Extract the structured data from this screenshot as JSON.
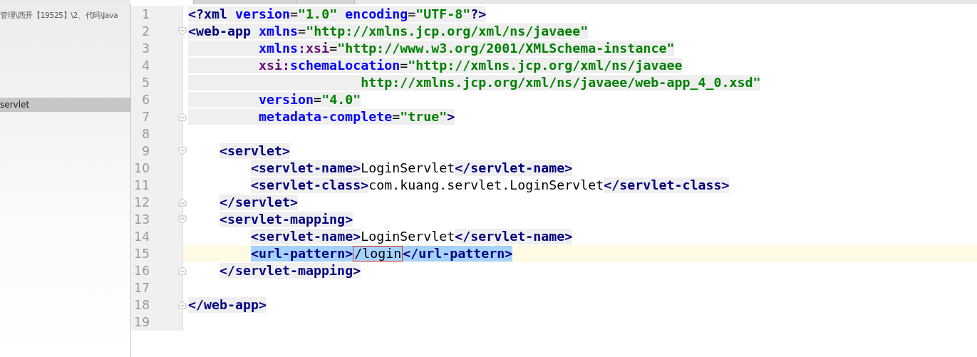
{
  "project_panel": {
    "path": "管理\\西开【19525】\\2、代码\\Java",
    "items": [
      {
        "label": "servlet",
        "selected": true
      }
    ]
  },
  "editor": {
    "lines": [
      {
        "number": "1",
        "fold_open": false,
        "fold_close": false,
        "current": false,
        "segments": [
          {
            "kind": "tag",
            "text": "<?xml"
          },
          {
            "kind": "attr",
            "text": " version"
          },
          {
            "kind": "plain",
            "text": "="
          },
          {
            "kind": "value",
            "text": "\"1.0\""
          },
          {
            "kind": "attr",
            "text": " encoding"
          },
          {
            "kind": "plain",
            "text": "="
          },
          {
            "kind": "value",
            "text": "\"UTF-8\""
          },
          {
            "kind": "tag",
            "text": "?>"
          }
        ]
      },
      {
        "number": "2",
        "fold_open": true,
        "fold_close": false,
        "current": false,
        "segments": [
          {
            "kind": "tag",
            "text": "<web-app"
          },
          {
            "kind": "attr",
            "text": " xmlns"
          },
          {
            "kind": "plain",
            "text": "="
          },
          {
            "kind": "value",
            "text": "\"http://xmlns.jcp.org/xml/ns/javaee\""
          }
        ]
      },
      {
        "number": "3",
        "fold_open": false,
        "fold_close": false,
        "current": false,
        "segments": [
          {
            "kind": "attr",
            "text": "         xmlns"
          },
          {
            "kind": "ns",
            "text": ":xsi"
          },
          {
            "kind": "plain",
            "text": "="
          },
          {
            "kind": "value",
            "text": "\"http://www.w3.org/2001/XMLSchema-instance\""
          }
        ]
      },
      {
        "number": "4",
        "fold_open": false,
        "fold_close": false,
        "current": false,
        "segments": [
          {
            "kind": "ns",
            "text": "         xsi:"
          },
          {
            "kind": "attr",
            "text": "schemaLocation"
          },
          {
            "kind": "plain",
            "text": "="
          },
          {
            "kind": "value",
            "text": "\"http://xmlns.jcp.org/xml/ns/javaee"
          }
        ]
      },
      {
        "number": "5",
        "fold_open": false,
        "fold_close": false,
        "current": false,
        "segments": [
          {
            "kind": "value",
            "text": "                      http://xmlns.jcp.org/xml/ns/javaee/web-app_4_0.xsd\""
          }
        ]
      },
      {
        "number": "6",
        "fold_open": false,
        "fold_close": false,
        "current": false,
        "segments": [
          {
            "kind": "attr",
            "text": "         version"
          },
          {
            "kind": "plain",
            "text": "="
          },
          {
            "kind": "value",
            "text": "\"4.0\""
          }
        ]
      },
      {
        "number": "7",
        "fold_open": false,
        "fold_close": true,
        "current": false,
        "segments": [
          {
            "kind": "attr",
            "text": "         metadata-complete"
          },
          {
            "kind": "plain",
            "text": "="
          },
          {
            "kind": "value",
            "text": "\"true\""
          },
          {
            "kind": "tag",
            "text": ">"
          }
        ]
      },
      {
        "number": "8",
        "fold_open": false,
        "fold_close": false,
        "current": false
      },
      {
        "number": "9",
        "fold_open": true,
        "fold_close": false,
        "current": false,
        "segments": [
          {
            "kind": "tag",
            "text": "    <servlet>"
          }
        ]
      },
      {
        "number": "10",
        "fold_open": false,
        "fold_close": false,
        "current": false,
        "segments": [
          {
            "kind": "tag",
            "text": "        <servlet-name>"
          },
          {
            "kind": "text",
            "text": "LoginServlet"
          },
          {
            "kind": "tag",
            "text": "</servlet-name>"
          }
        ]
      },
      {
        "number": "11",
        "fold_open": false,
        "fold_close": false,
        "current": false,
        "segments": [
          {
            "kind": "tag",
            "text": "        <servlet-class>"
          },
          {
            "kind": "text",
            "text": "com.kuang.servlet.LoginServlet"
          },
          {
            "kind": "tag",
            "text": "</servlet-class>"
          }
        ]
      },
      {
        "number": "12",
        "fold_open": false,
        "fold_close": true,
        "current": false,
        "segments": [
          {
            "kind": "tag",
            "text": "    </servlet>"
          }
        ]
      },
      {
        "number": "13",
        "fold_open": true,
        "fold_close": false,
        "current": false,
        "segments": [
          {
            "kind": "tag",
            "text": "    <servlet-mapping>"
          }
        ]
      },
      {
        "number": "14",
        "fold_open": false,
        "fold_close": false,
        "current": false,
        "segments": [
          {
            "kind": "tag",
            "text": "        <servlet-name>"
          },
          {
            "kind": "text",
            "text": "LoginServlet"
          },
          {
            "kind": "tag",
            "text": "</servlet-name>"
          }
        ]
      },
      {
        "number": "15",
        "fold_open": false,
        "fold_close": false,
        "current": true,
        "segments": [
          {
            "kind": "tag",
            "text": "        <url-pattern>",
            "selected": true
          },
          {
            "kind": "text",
            "text": "/login",
            "selected": true,
            "boxed": true
          },
          {
            "kind": "tag",
            "text": "</url-pattern>",
            "selected": true
          }
        ]
      },
      {
        "number": "16",
        "fold_open": false,
        "fold_close": true,
        "current": false,
        "segments": [
          {
            "kind": "tag",
            "text": "    </servlet-mapping>"
          }
        ]
      },
      {
        "number": "17",
        "fold_open": false,
        "fold_close": false,
        "current": false
      },
      {
        "number": "18",
        "fold_open": false,
        "fold_close": true,
        "current": false,
        "segments": [
          {
            "kind": "tag",
            "text": "</web-app>"
          }
        ]
      },
      {
        "number": "19",
        "fold_open": false,
        "fold_close": false,
        "current": false
      }
    ]
  }
}
